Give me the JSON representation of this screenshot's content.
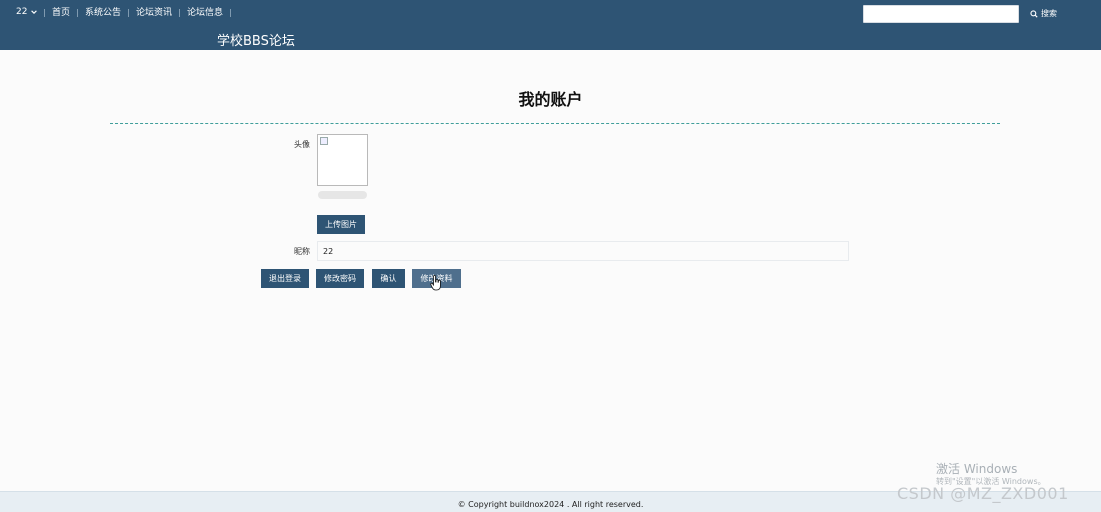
{
  "topbar": {
    "user_label": "22",
    "nav_items": [
      "首页",
      "系统公告",
      "论坛资讯",
      "论坛信息"
    ],
    "search_placeholder": "",
    "search_label": "搜索"
  },
  "site_title": "学校BBS论坛",
  "page_title": "我的账户",
  "form": {
    "avatar_label": "头像",
    "upload_label": "上传图片",
    "upload_progress": 0,
    "nickname_label": "昵称",
    "nickname_value": "22"
  },
  "actions": {
    "logout": "退出登录",
    "change_password": "修改密码",
    "confirm": "确认",
    "edit_profile": "修改资料"
  },
  "footer": {
    "copyright": "© Copyright buildnox2024 . All right reserved."
  },
  "overlays": {
    "activate_title": "激活 Windows",
    "activate_hint": "转到\"设置\"以激活 Windows。",
    "csdn_watermark": "CSDN @MZ_ZXD001"
  },
  "colors": {
    "primary": "#2e5474",
    "divider": "#3f9e9a",
    "footer_bg": "#e7eef3"
  }
}
